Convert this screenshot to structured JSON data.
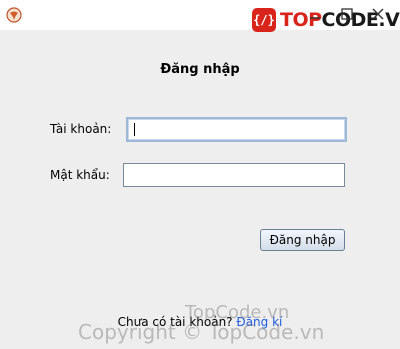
{
  "title_bar": {
    "logo_prefix": "TOP",
    "logo_suffix": "CODE.VN"
  },
  "form": {
    "heading": "Đăng nhập",
    "username_label": "Tài khoản:",
    "username_value": "",
    "password_label": "Mật khẩu:",
    "password_value": "",
    "submit_label": "Đăng nhập"
  },
  "footer": {
    "prompt": "Chưa có tài khoản?",
    "register_link": "Đăng kí"
  },
  "watermark": {
    "line1": "TopCode.vn",
    "line2": "Copyright © TopCode.vn"
  },
  "colors": {
    "window_bg": "#eeeeee",
    "link": "#1e5be0",
    "logo_red": "#d9241c"
  }
}
